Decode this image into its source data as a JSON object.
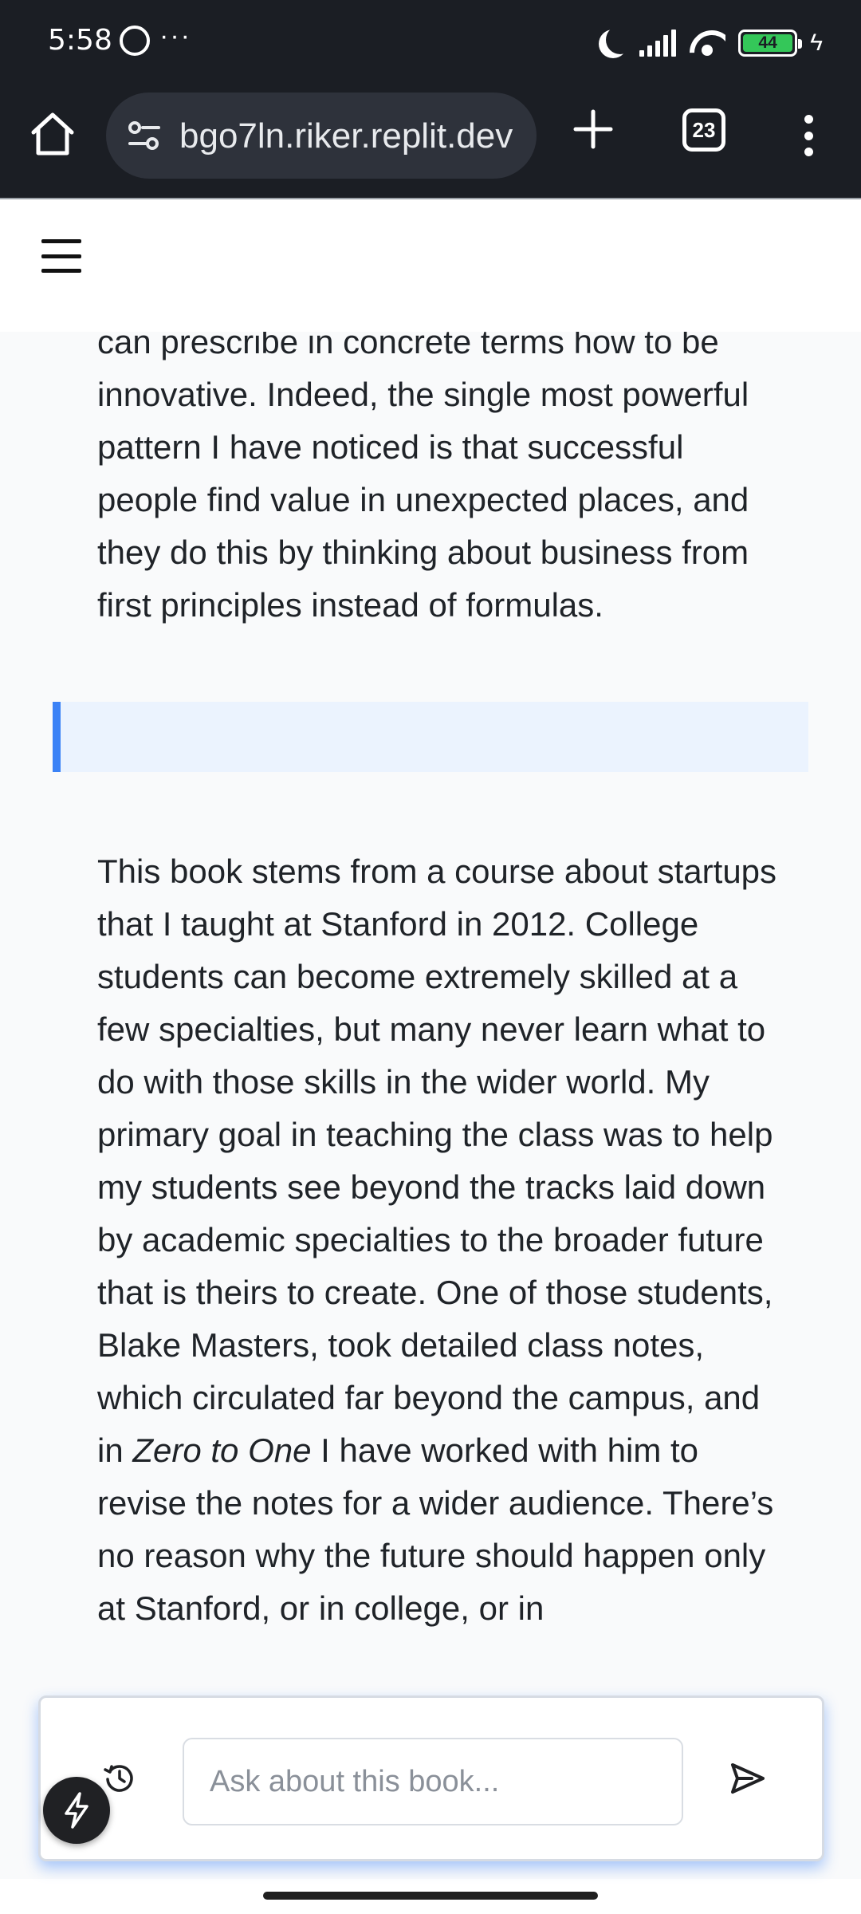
{
  "status_bar": {
    "time": "5:58",
    "notification_icons": [
      "whatsapp-icon",
      "more-dots-icon"
    ],
    "more_dots": "···",
    "battery_level": "44",
    "battery_color": "#34c759",
    "charging_symbol": "ϟ"
  },
  "browser": {
    "url": "bgo7ln.riker.replit.dev",
    "tab_count": "23",
    "icons": [
      "home-icon",
      "site-settings-icon",
      "new-tab-icon",
      "tab-switcher-icon",
      "overflow-menu-icon"
    ]
  },
  "app_header": {
    "icons": [
      "hamburger-menu-icon"
    ]
  },
  "content": {
    "paragraph_1": "can prescribe in concrete terms how to be innovative. Indeed, the single most powerful pattern I have noticed is that successful people find value in unexpected places, and they do this by thinking about business from first principles instead of formulas.",
    "paragraph_2_before": "This book stems from a course about startups that I taught at Stanford in 2012. College students can become extremely skilled at a few specialties, but many never learn what to do with those skills in the wider world. My primary goal in teaching the class was to help my students see beyond the tracks laid down by academic specialties to the broader future that is theirs to create. One of those students, Blake Masters, took detailed class notes, which circulated far beyond the campus, and in ",
    "paragraph_2_title": "Zero to One",
    "paragraph_2_after": " I have worked with him to revise the notes for a wider audience. There’s no reason why the future should happen only at Stanford, or in college, or in",
    "quote_accent_color": "#3b82f6",
    "quote_background": "#ebf3fe"
  },
  "chat": {
    "placeholder": "Ask about this book...",
    "icons": [
      "history-icon",
      "send-icon",
      "lightning-icon"
    ]
  }
}
